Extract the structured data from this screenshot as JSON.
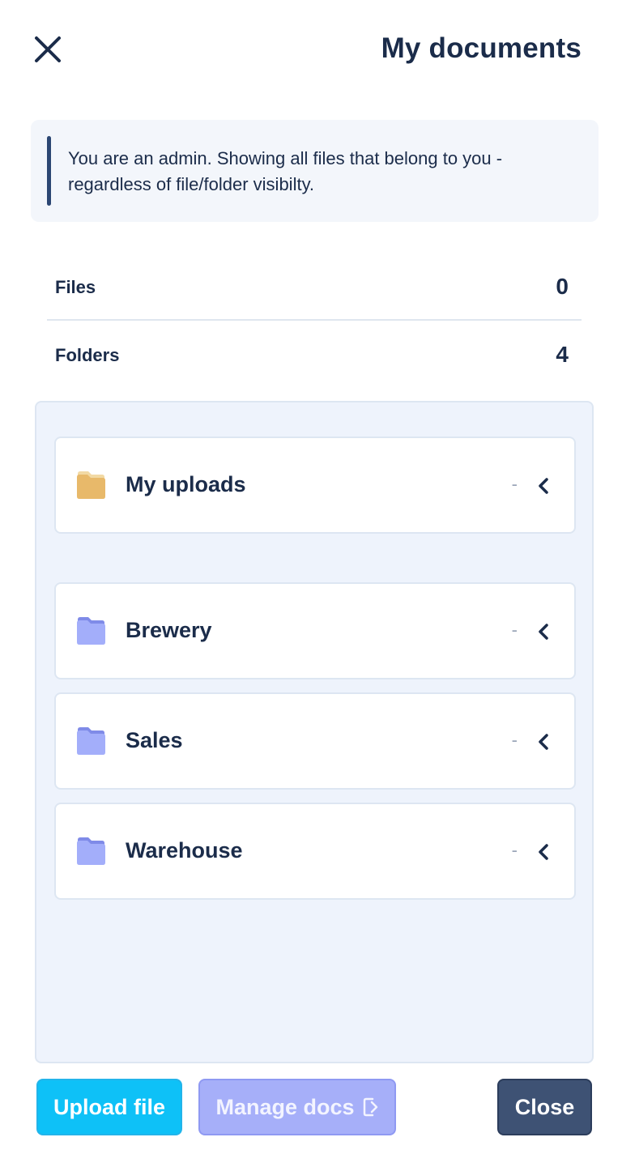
{
  "header": {
    "title": "My documents",
    "close_icon": "close-icon"
  },
  "notice": {
    "text": "You are an admin. Showing all files that belong to you - regardless of file/folder visibilty."
  },
  "stats": [
    {
      "label": "Files",
      "value": "0"
    },
    {
      "label": "Folders",
      "value": "4"
    }
  ],
  "folders": [
    {
      "name": "My uploads",
      "meta": "-",
      "icon": "folder-icon",
      "color": "#e8b96a"
    },
    {
      "name": "Brewery",
      "meta": "-",
      "icon": "folder-icon",
      "color": "#a3aefa"
    },
    {
      "name": "Sales",
      "meta": "-",
      "icon": "folder-icon",
      "color": "#a3aefa"
    },
    {
      "name": "Warehouse",
      "meta": "-",
      "icon": "folder-icon",
      "color": "#a3aefa"
    }
  ],
  "footer": {
    "upload_label": "Upload file",
    "manage_label": "Manage docs",
    "close_label": "Close"
  },
  "colors": {
    "primary_text": "#1b2c4a",
    "upload_button": "#0ec1f7",
    "manage_button": "#a6aff9",
    "close_button": "#3e5274",
    "panel_bg": "#eef3fc"
  }
}
